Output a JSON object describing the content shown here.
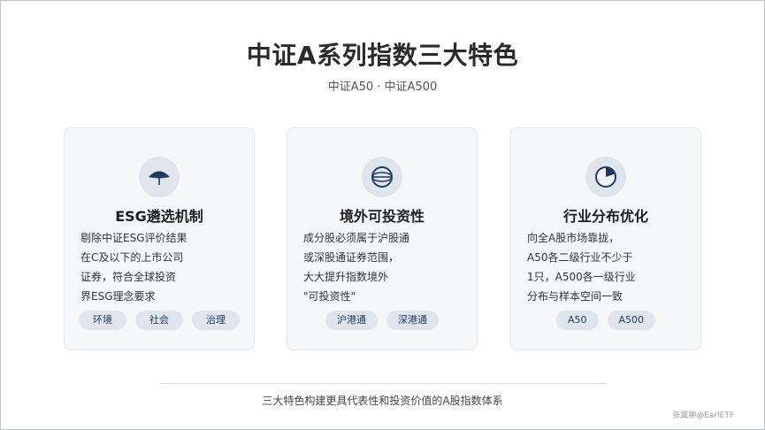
{
  "header": {
    "title": "中证A系列指数三大特色",
    "subtitle": "中证A50 · 中证A500"
  },
  "cards": [
    {
      "icon": "leaf-icon",
      "title": "ESG遴选机制",
      "lines": [
        "剔除中证ESG评价结果",
        "在C及以下的上市公司",
        "证券，符合全球投资",
        "界ESG理念要求"
      ],
      "tags": [
        "环境",
        "社会",
        "治理"
      ]
    },
    {
      "icon": "globe-icon",
      "title": "境外可投资性",
      "lines": [
        "成分股必须属于沪股通",
        "或深股通证券范围，",
        "大大提升指数境外",
        "\"可投资性\""
      ],
      "tags": [
        "沪港通",
        "深港通"
      ]
    },
    {
      "icon": "pie-chart-icon",
      "title": "行业分布优化",
      "lines": [
        "向全A股市场靠拢，",
        "A50各二级行业不少于",
        "1只，A500各一级行业",
        "分布与样本空间一致"
      ],
      "tags": [
        "A50",
        "A500"
      ]
    }
  ],
  "footer": {
    "text": "三大特色构建更具代表性和投资价值的A股指数体系",
    "credit": "张翼翀@EarlETF"
  },
  "colors": {
    "accent": "#1f3a5f",
    "icon_bg": "#dfe4ed",
    "card_bg": "#f6f7f9"
  }
}
